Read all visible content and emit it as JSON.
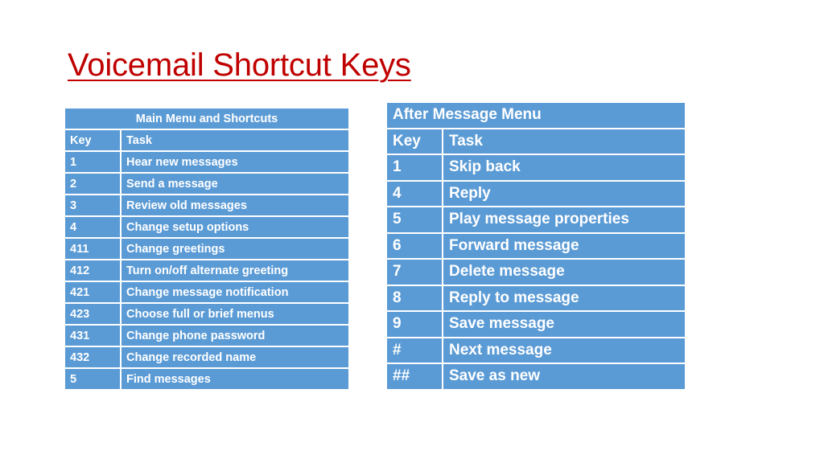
{
  "slide": {
    "title": "Voicemail Shortcut Keys",
    "title_color": "#C00000",
    "table_fill_color": "#5B9BD5",
    "text_color": "#FFFFFF",
    "background_color": "#FFFFFF"
  },
  "main_menu_table": {
    "merged_header": "Main Menu and Shortcuts",
    "columns": [
      "Key",
      "Task"
    ],
    "rows": [
      {
        "key": "1",
        "task": "Hear new messages"
      },
      {
        "key": "2",
        "task": "Send a message"
      },
      {
        "key": "3",
        "task": "Review old messages"
      },
      {
        "key": "4",
        "task": "Change setup options"
      },
      {
        "key": "411",
        "task": "Change greetings"
      },
      {
        "key": "412",
        "task": "Turn on/off alternate greeting"
      },
      {
        "key": "421",
        "task": "Change message notification"
      },
      {
        "key": "423",
        "task": "Choose full or brief menus"
      },
      {
        "key": "431",
        "task": "Change phone password"
      },
      {
        "key": "432",
        "task": "Change recorded name"
      },
      {
        "key": "5",
        "task": "Find messages"
      }
    ]
  },
  "after_message_table": {
    "merged_header": "After Message Menu",
    "columns": [
      "Key",
      "Task"
    ],
    "rows": [
      {
        "key": "1",
        "task": "Skip back"
      },
      {
        "key": "4",
        "task": "Reply"
      },
      {
        "key": "5",
        "task": "Play message properties"
      },
      {
        "key": "6",
        "task": "Forward message"
      },
      {
        "key": "7",
        "task": "Delete message"
      },
      {
        "key": "8",
        "task": "Reply to message"
      },
      {
        "key": "9",
        "task": "Save message"
      },
      {
        "key": "#",
        "task": "Next message"
      },
      {
        "key": "##",
        "task": "Save as new"
      }
    ]
  }
}
